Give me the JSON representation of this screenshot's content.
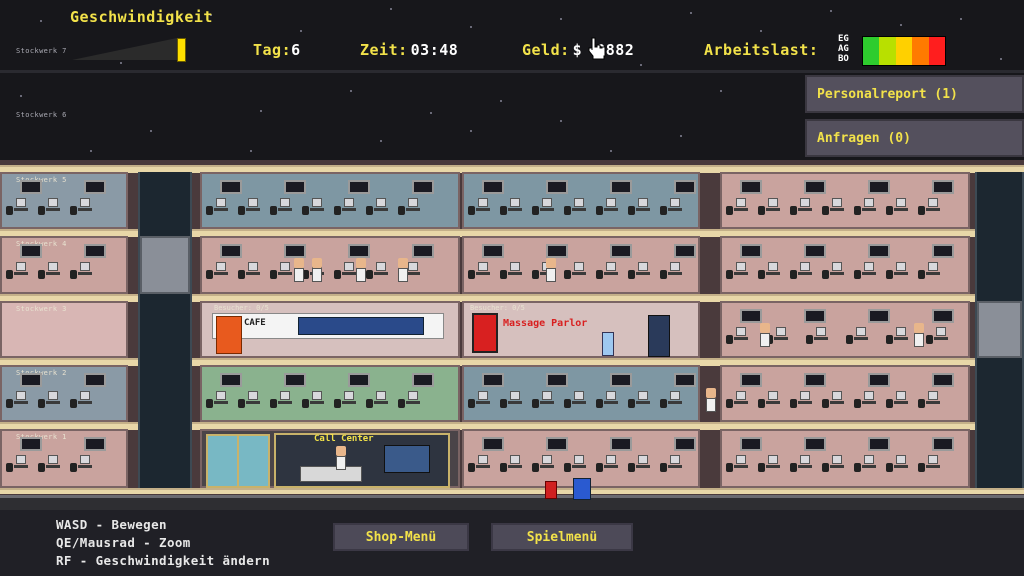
{
  "hud": {
    "speed_label": "Geschwindigkeit",
    "day_label": "Tag:",
    "day_value": "6",
    "time_label": "Zeit:",
    "time_value": "03:48",
    "money_label": "Geld:",
    "money_value": "$",
    "money_tail": "0882",
    "workload_label": "Arbeitslast:",
    "workload_rows": [
      "EG",
      "AG",
      "BO"
    ]
  },
  "floors": {
    "f7": "Stockwerk 7",
    "f6": "Stockwerk 6",
    "f5": "Stockwerk 5",
    "f4": "Stockwerk 4",
    "f3": "Stockwerk 3",
    "f2": "Stockwerk 2",
    "f1": "Stockwerk 1"
  },
  "side_panel": {
    "personal": "Personalreport (1)",
    "requests": "Anfragen (0)"
  },
  "rooms": {
    "visitors_cafe": "Besucher: 0/5",
    "visitors_massage": "Besucher: 0/5",
    "cafe_sign": "CAFE",
    "massage_sign": "Massage Parlor",
    "call_center_sign": "Call Center"
  },
  "controls": {
    "line1": "WASD - Bewegen",
    "line2": "QE/Mausrad - Zoom",
    "line3": "RF - Geschwindigkeit ändern"
  },
  "buttons": {
    "shop": "Shop-Menü",
    "game": "Spielmenü"
  },
  "colors": {
    "hud_yellow": "#f2e24a",
    "workload_gradient": [
      "#2ecc2e",
      "#b8e000",
      "#ffd000",
      "#ff7a00",
      "#ff1e1e"
    ]
  }
}
